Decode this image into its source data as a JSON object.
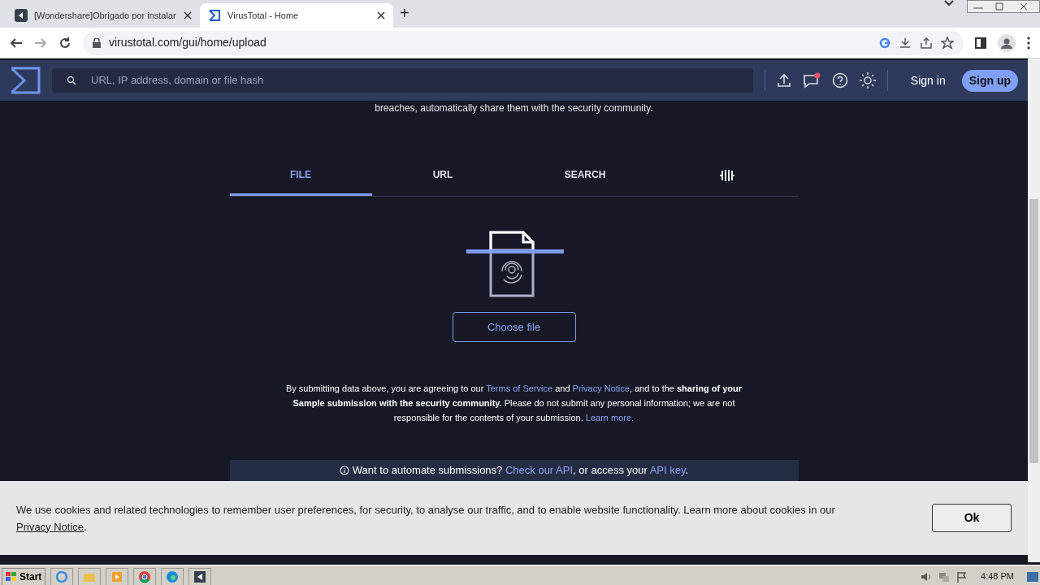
{
  "browser": {
    "tabs": [
      {
        "title": "[Wondershare]Obrigado por instalar",
        "selected": false
      },
      {
        "title": "VirusTotal - Home",
        "selected": true
      }
    ],
    "new_tab": "+",
    "url": "virustotal.com/gui/home/upload"
  },
  "header": {
    "search_placeholder": "URL, IP address, domain or file hash",
    "notification": true,
    "sign_in": "Sign in",
    "sign_up": "Sign up"
  },
  "intro": "breaches, automatically share them with the security community.",
  "tabs": [
    {
      "label": "FILE",
      "selected": true
    },
    {
      "label": "URL",
      "selected": false
    },
    {
      "label": "SEARCH",
      "selected": false
    }
  ],
  "choose_button": "Choose file",
  "disclaimer": [
    {
      "kind": "text",
      "text": "By submitting data above, you are agreeing to our "
    },
    {
      "kind": "link",
      "text": "Terms of Service"
    },
    {
      "kind": "text",
      "text": " and "
    },
    {
      "kind": "link",
      "text": "Privacy Notice"
    },
    {
      "kind": "text",
      "text": ", and to the **sharing of your Sample submission with the security community.** Please do not submit any personal information; we are not responsible for the contents of your submission. "
    },
    {
      "kind": "link",
      "text": "Learn more."
    }
  ],
  "api_bar": [
    {
      "kind": "text",
      "text": "Want to automate submissions? "
    },
    {
      "kind": "link",
      "text": "Check our API"
    },
    {
      "kind": "text",
      "text": ", or access your "
    },
    {
      "kind": "link",
      "text": "API key"
    },
    {
      "kind": "text",
      "text": "."
    }
  ],
  "cookie": {
    "parts": [
      {
        "kind": "text",
        "text": "We use cookies and related technologies to remember user preferences, for security, to analyse our traffic, and to enable website functionality. Learn more about cookies in our "
      },
      {
        "kind": "link",
        "text": "Privacy Notice"
      },
      {
        "kind": "text",
        "text": "."
      }
    ],
    "button": "Ok"
  },
  "taskbar": {
    "start": "Start",
    "clock": "4:48 PM"
  }
}
